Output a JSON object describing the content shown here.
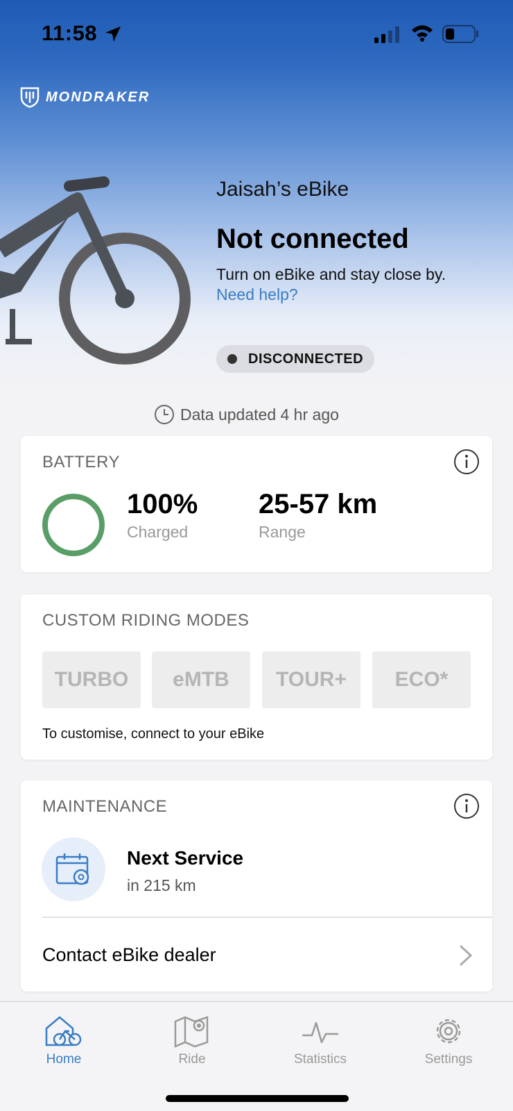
{
  "status_bar": {
    "time": "11:58"
  },
  "brand": {
    "name": "MONDRAKER"
  },
  "bike": {
    "name": "Jaisah’s eBike",
    "connection_title": "Not connected",
    "connection_hint": "Turn on eBike and stay close by.",
    "help_link": "Need help?",
    "status_badge": "DISCONNECTED"
  },
  "updated": {
    "text": "Data updated 4 hr ago"
  },
  "battery": {
    "title": "BATTERY",
    "percent_value": "100%",
    "percent_label": "Charged",
    "range_value": "25-57 km",
    "range_label": "Range",
    "charge_fraction": 1.0,
    "ring_color": "#5a9e67"
  },
  "riding_modes": {
    "title": "CUSTOM RIDING MODES",
    "modes": [
      "TURBO",
      "eMTB",
      "TOUR+",
      "ECO*"
    ],
    "note": "To customise, connect to your eBike"
  },
  "maintenance": {
    "title": "MAINTENANCE",
    "service_title": "Next Service",
    "service_sub": "in 215 km",
    "dealer_label": "Contact eBike dealer"
  },
  "tabs": [
    {
      "label": "Home",
      "icon": "home-bike-icon",
      "active": true
    },
    {
      "label": "Ride",
      "icon": "map-icon",
      "active": false
    },
    {
      "label": "Statistics",
      "icon": "pulse-icon",
      "active": false
    },
    {
      "label": "Settings",
      "icon": "gear-icon",
      "active": false
    }
  ],
  "colors": {
    "accent": "#3a7cc4",
    "header_top": "#1f5bb5"
  }
}
